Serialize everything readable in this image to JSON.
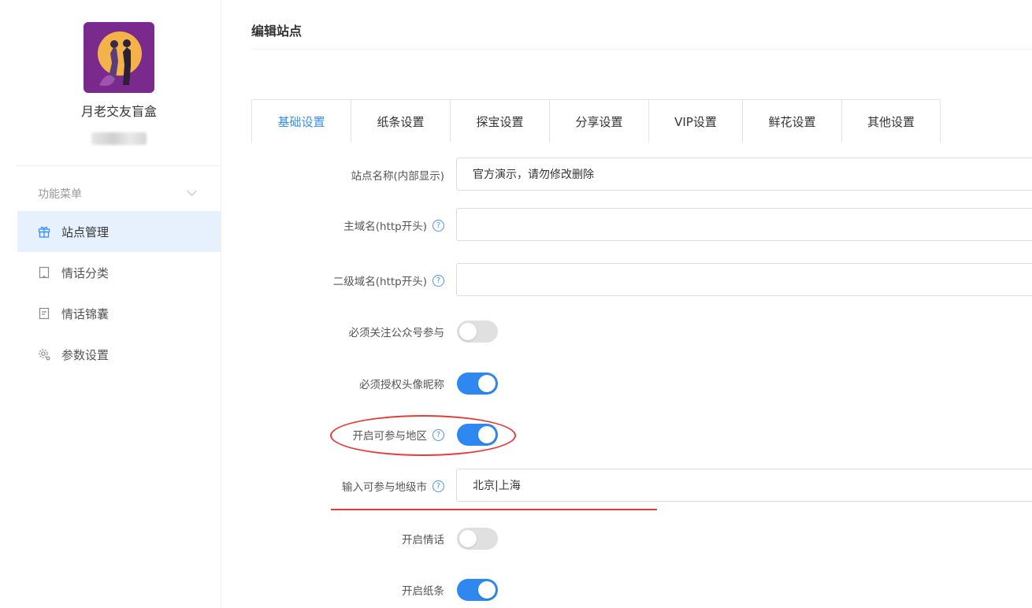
{
  "sidebar": {
    "app_name": "月老交友盲盒",
    "menu_header": "功能菜单",
    "items": [
      {
        "label": "站点管理",
        "icon": "gift-icon",
        "active": true
      },
      {
        "label": "情话分类",
        "icon": "bookmark-icon",
        "active": false
      },
      {
        "label": "情话锦囊",
        "icon": "document-icon",
        "active": false
      },
      {
        "label": "参数设置",
        "icon": "gear-icon",
        "active": false
      }
    ]
  },
  "main": {
    "title": "编辑站点",
    "tabs": [
      {
        "label": "基础设置",
        "active": true
      },
      {
        "label": "纸条设置",
        "active": false
      },
      {
        "label": "探宝设置",
        "active": false
      },
      {
        "label": "分享设置",
        "active": false
      },
      {
        "label": "VIP设置",
        "active": false
      },
      {
        "label": "鲜花设置",
        "active": false
      },
      {
        "label": "其他设置",
        "active": false
      }
    ],
    "fields": {
      "site_name": {
        "label": "站点名称(内部显示)",
        "value": "官方演示，请勿修改删除"
      },
      "main_domain": {
        "label": "主域名(http开头)",
        "value": ""
      },
      "sub_domain": {
        "label": "二级域名(http开头)",
        "value": ""
      },
      "follow_account": {
        "label": "必须关注公众号参与",
        "on": false
      },
      "auth_avatar": {
        "label": "必须授权头像昵称",
        "on": true
      },
      "open_region": {
        "label": "开启可参与地区",
        "on": true
      },
      "region_cities": {
        "label": "输入可参与地级市",
        "value": "北京|上海"
      },
      "open_love_words": {
        "label": "开启情话",
        "on": false
      },
      "open_notes": {
        "label": "开启纸条",
        "on": true
      }
    }
  },
  "colors": {
    "accent": "#2f87f0",
    "active_menu_bg": "#e6f1fd",
    "annotation": "#e63b3b"
  }
}
